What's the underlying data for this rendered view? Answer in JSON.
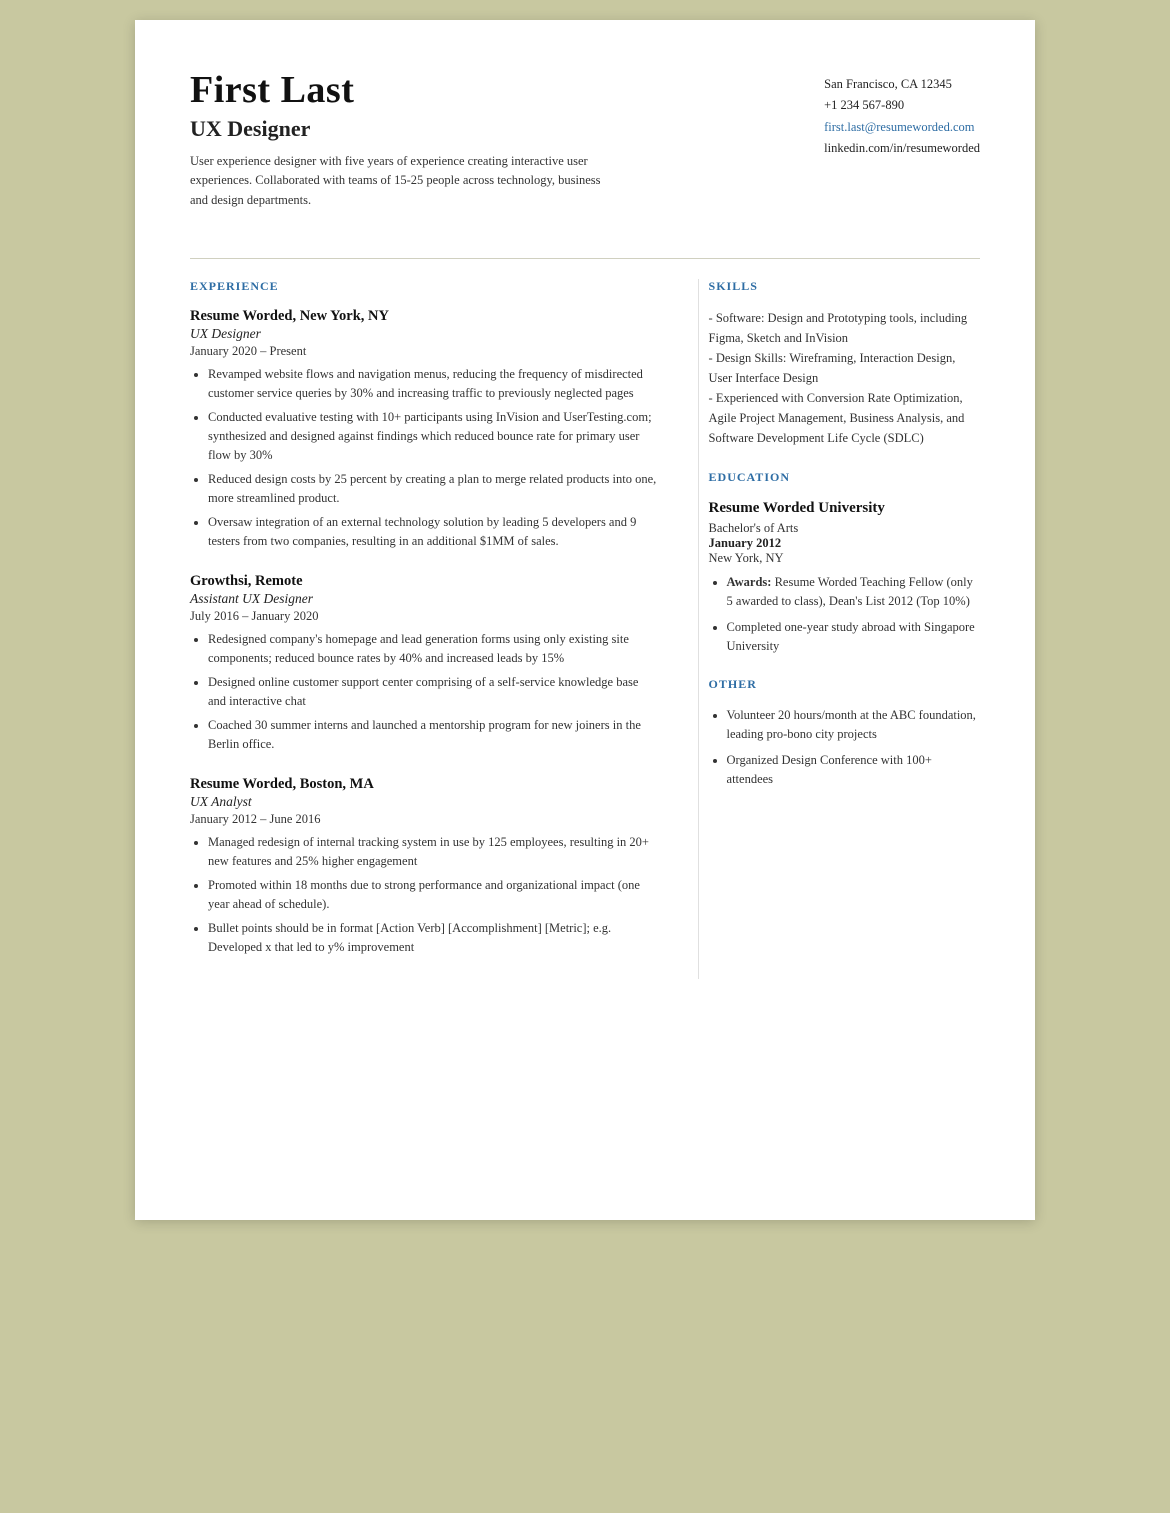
{
  "header": {
    "name": "First Last",
    "title": "UX Designer",
    "summary": "User experience designer with five years of experience creating interactive user experiences. Collaborated with teams of 15-25 people across technology, business and design departments.",
    "contact": {
      "address": "San Francisco, CA 12345",
      "phone": "+1 234 567-890",
      "email": "first.last@resumeworded.com",
      "linkedin": "linkedin.com/in/resumeworded"
    }
  },
  "sections": {
    "experience_title": "EXPERIENCE",
    "skills_title": "SKILLS",
    "education_title": "EDUCATION",
    "other_title": "OTHER"
  },
  "experience": [
    {
      "company": "Resume Worded,",
      "location": " New York, NY",
      "title": "UX Designer",
      "dates": "January 2020 – Present",
      "bullets": [
        "Revamped website flows and navigation menus, reducing the frequency of misdirected customer service queries by 30% and increasing traffic to previously neglected pages",
        "Conducted evaluative testing with 10+ participants using InVision and UserTesting.com; synthesized and designed against findings which reduced bounce rate for primary user flow by 30%",
        "Reduced design costs by 25 percent by creating a plan to merge related products into one, more streamlined product.",
        "Oversaw integration of an external technology solution by leading 5 developers and 9 testers from two companies, resulting in an additional $1MM of sales."
      ]
    },
    {
      "company": "Growthsi,",
      "location": " Remote",
      "title": "Assistant UX Designer",
      "dates": "July 2016 – January 2020",
      "bullets": [
        "Redesigned company's homepage and lead generation forms using only existing site components; reduced bounce rates by 40% and increased leads by 15%",
        "Designed online customer support center comprising of a self-service knowledge base and interactive chat",
        "Coached 30 summer interns and launched a mentorship program for new joiners in the Berlin office."
      ]
    },
    {
      "company": "Resume Worded,",
      "location": " Boston, MA",
      "title": "UX Analyst",
      "dates": "January 2012 – June 2016",
      "bullets": [
        "Managed redesign of internal tracking system in use by 125 employees, resulting in 20+ new features and 25% higher engagement",
        "Promoted within 18 months due to strong performance and organizational impact (one year ahead of schedule).",
        "Bullet points should be in format [Action Verb] [Accomplishment] [Metric]; e.g. Developed x that led to y% improvement"
      ]
    }
  ],
  "skills": "- Software: Design and Prototyping tools, including Figma, Sketch and InVision\n- Design Skills: Wireframing, Interaction Design, User Interface Design\n- Experienced with Conversion Rate Optimization, Agile Project Management, Business Analysis, and Software Development Life Cycle (SDLC)",
  "education": {
    "school": "Resume Worded University",
    "degree": "Bachelor's of Arts",
    "year": "January 2012",
    "location": "New York, NY",
    "bullets": [
      {
        "label": "Awards:",
        "text": " Resume Worded Teaching Fellow (only 5 awarded to class), Dean's List 2012 (Top 10%)"
      },
      {
        "label": "",
        "text": "Completed one-year study abroad with Singapore University"
      }
    ]
  },
  "other": [
    "Volunteer 20 hours/month at the ABC foundation, leading pro-bono city projects",
    "Organized Design Conference with 100+ attendees"
  ]
}
